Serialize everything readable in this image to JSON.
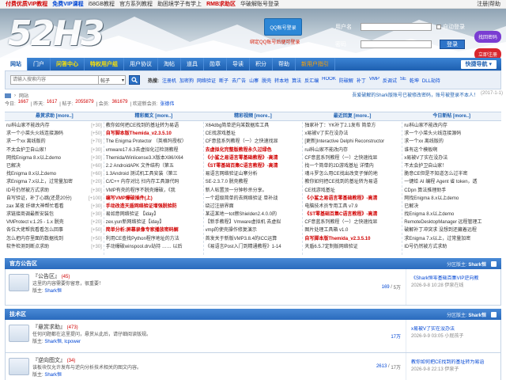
{
  "topbar": {
    "links": [
      "付费优质VIP教程",
      "免费VIP课程",
      "i58GB教程",
      "官方系列教程",
      "助困境学子有学上",
      "RMB求助区",
      "华破解账号登录"
    ],
    "styles": [
      "hl-red",
      "hl-blue",
      "",
      "",
      "",
      "hl-red",
      ""
    ],
    "right": "注册|帮助"
  },
  "header": {
    "logo": "52H3",
    "qq_btn": "QQ账号登录",
    "qq_tip": "绑定QQ账号后便可登录",
    "login": {
      "user_label": "用户名",
      "user_placeholder": "",
      "auto_label": "自动登录",
      "pass_label": "密码",
      "login_btn": "登录"
    },
    "find_btn": "找回密码",
    "reg_btn": "立即注册"
  },
  "nav": {
    "items": [
      {
        "label": "网站",
        "style": "on"
      },
      {
        "label": "门户",
        "style": ""
      },
      {
        "label": "问答中心",
        "style": "y"
      },
      {
        "label": "特权用户组",
        "style": "y"
      },
      {
        "label": "用户协议",
        "style": ""
      },
      {
        "label": "淘帖",
        "style": ""
      },
      {
        "label": "道具",
        "style": ""
      },
      {
        "label": "勋章",
        "style": ""
      },
      {
        "label": "导读",
        "style": ""
      },
      {
        "label": "积分",
        "style": ""
      },
      {
        "label": "帮助",
        "style": ""
      },
      {
        "label": "新用户指引",
        "style": "o"
      }
    ],
    "quick": "快捷导航 ▾"
  },
  "search": {
    "placeholder": "请输入搜索内容",
    "scope": "帖子",
    "hot_label": "热搜:",
    "hot": [
      "注册机",
      "加密狗",
      "网络验证",
      "断子",
      "去广告",
      "山寨",
      "脱壳",
      "转本地",
      "算法",
      "反汇编",
      "HOOK",
      "防破解",
      "补丁",
      "VMP",
      "反调试",
      "SE",
      "乾坤",
      "DLL劫持"
    ]
  },
  "crumb": {
    "text": "网站"
  },
  "notice": {
    "text": "吾爱破解的Shark版账号已被修改密码，账号被登录不本人！",
    "date": "(2017-1-1)"
  },
  "stats": {
    "labels": [
      "今日:",
      "| 昨天:",
      "| 帖子:",
      "| 会员:",
      "| 欢迎新会员:"
    ],
    "values": [
      "1667",
      "1617",
      "2055879",
      "361679",
      "张德伟"
    ]
  },
  "columns": {
    "headers": [
      "悬赏求助 [more..]",
      "精彩图文 [more..]",
      "精彩视频 [more..]",
      "最近回复 [more..]",
      "今日新帖 [more..]"
    ],
    "lists": [
      [
        {
          "t": "rui科山家不能改内存",
          "n": "[+30]",
          "s": ""
        },
        {
          "t": "求一个小菜头火线连接源码",
          "n": "[+50]",
          "s": ""
        },
        {
          "t": "求一个xx 离线版的",
          "n": "[+70]",
          "s": ""
        },
        {
          "t": "不太会护卫自山家！",
          "n": "[+30]",
          "s": ""
        },
        {
          "t": "网找Enigma 8.x以上demo",
          "n": "[+30]",
          "s": ""
        },
        {
          "t": "已解决",
          "n": "[+60]",
          "s": ""
        },
        {
          "t": "找Enigma 8.x以上demo",
          "n": "[+60]",
          "s": ""
        },
        {
          "t": "求Enigma 7.x以上，过常量加密",
          "n": "[+20]",
          "s": ""
        },
        {
          "t": "ID号仍然被方式求助",
          "n": "[+30]",
          "s": ""
        },
        {
          "t": "自写验证，补丁心跳(还是20分)",
          "n": "[+100]",
          "s": ""
        },
        {
          "t": "zax 某夜 纤继大神帮忙看看",
          "n": "[+30]",
          "s": ""
        },
        {
          "t": "求链接商调最新安装包",
          "n": "[+30]",
          "s": ""
        },
        {
          "t": "VMProtect v.1.25 - 1.x 脱壳",
          "n": "[+20]",
          "s": ""
        },
        {
          "t": "各位大佬帮我看看怎么回事",
          "n": "[+50]",
          "s": ""
        },
        {
          "t": "怎么把内存里面的数据找到",
          "n": "[+50]",
          "s": ""
        },
        {
          "t": "软件检测到断点求助",
          "n": "[+30]",
          "s": ""
        }
      ],
      [
        {
          "t": "教你如何把CE找到的基址转为易语",
          "n": "",
          "s": ""
        },
        {
          "t": "自写脚本版Themida_v2.3.5.10",
          "n": "",
          "s": "r"
        },
        {
          "t": "The Enigma Protector （英格玛授权）",
          "n": "",
          "s": ""
        },
        {
          "t": "vmware17.6.3去虚拟化过检测教程",
          "n": "",
          "s": ""
        },
        {
          "t": "Themida/Winlicense3.X版本X86/X64",
          "n": "",
          "s": ""
        },
        {
          "t": "2.2 AndroidAPK 文件结构（第五",
          "n": "",
          "s": ""
        },
        {
          "t": "1.3Android 测试机工具安装（第三",
          "n": "",
          "s": ""
        },
        {
          "t": "C/C++ 内存对比 扫内存工具源代码",
          "n": "",
          "s": ""
        },
        {
          "t": "VMP有壳的程序不脱壳爆破，《我",
          "n": "",
          "s": ""
        },
        {
          "t": "编写VMP爆破插件(上)",
          "n": "",
          "s": "r"
        },
        {
          "t": "手动改造天盾网络验证增强脱验防",
          "n": "",
          "s": "r"
        },
        {
          "t": "易如意网络验证 【iday】",
          "n": "",
          "s": ""
        },
        {
          "t": "zex.yun新网络验证【iday】",
          "n": "",
          "s": ""
        },
        {
          "t": "简单分析:屏幕录像专家播放密码解",
          "n": "",
          "s": "r"
        },
        {
          "t": "利用CE查找Python程序地址的方法",
          "n": "",
          "s": ""
        },
        {
          "t": "手动爆破winspool.drv劫持 …… 以后",
          "n": "",
          "s": ""
        }
      ],
      [
        {
          "t": "X64dbg简单逆向某数据库工具",
          "n": "",
          "s": ""
        },
        {
          "t": "CE找游戏基址",
          "n": "",
          "s": ""
        },
        {
          "t": "CF意蓝系列教程（一）之快速找显",
          "n": "",
          "s": ""
        },
        {
          "t": "去虚拟化完整版教程永久过绿色",
          "n": "",
          "s": "r"
        },
        {
          "t": "《小鲨之易语言零基础教程》-高清",
          "n": "",
          "s": "r"
        },
        {
          "t": "《ST零基础百集C语言教程》-高清",
          "n": "",
          "s": "r"
        },
        {
          "t": "易语言网络验证山寨分析",
          "n": "",
          "s": ""
        },
        {
          "t": "SE-2.3.7.0 脱壳教程",
          "n": "",
          "s": ""
        },
        {
          "t": "新人帖置顶一分钟秒杀分享。",
          "n": "",
          "s": ""
        },
        {
          "t": "一个超级简单的去网络验证 单补战",
          "n": "",
          "s": ""
        },
        {
          "t": "绕过注册界面",
          "n": "",
          "s": ""
        },
        {
          "t": "某逗某地一tot擦Shielden2.4.0.0的",
          "n": "",
          "s": ""
        },
        {
          "t": "【新手教程】Vmware虚拟机 去虚拟",
          "n": "",
          "s": ""
        },
        {
          "t": "vmp的使壳操作修复演示",
          "n": "",
          "s": ""
        },
        {
          "t": "首发关于新版VMP3.8.4的ICC运算",
          "n": "",
          "s": ""
        },
        {
          "t": "《易语言Post入门到精通教程》1-14",
          "n": "",
          "s": ""
        }
      ],
      [
        {
          "t": "独家补丁：YK补丁2.1发布 简单方",
          "n": "",
          "s": ""
        },
        {
          "t": "x易被V了实在没办法",
          "n": "",
          "s": ""
        },
        {
          "t": "[更新]Interactive Delphi Reconstructor",
          "n": "",
          "s": ""
        },
        {
          "t": "rui科山家不能改内存",
          "n": "",
          "s": ""
        },
        {
          "t": "CF意蓝系列教程（一）之快速找显",
          "n": "",
          "s": ""
        },
        {
          "t": "找一个简单的2D游戏基址 详情内",
          "n": "",
          "s": ""
        },
        {
          "t": "魂斗罗怎么用CE找出改变子弹的地",
          "n": "",
          "s": ""
        },
        {
          "t": "教你如何把CE找到的基址转为易语",
          "n": "",
          "s": ""
        },
        {
          "t": "CE找游戏基址",
          "n": "",
          "s": ""
        },
        {
          "t": "《小鲨之易语言零基础教程》-高清",
          "n": "",
          "s": "r"
        },
        {
          "t": "电脑技术员专用工具 v7.9",
          "n": "",
          "s": ""
        },
        {
          "t": "《ST零基础百集C语言教程》-高清",
          "n": "",
          "s": "r"
        },
        {
          "t": "CF意蓝系列教程（一）之快速找显",
          "n": "",
          "s": ""
        },
        {
          "t": "图片处理工具箱 v1.0",
          "n": "",
          "s": ""
        },
        {
          "t": "自写脚本版Themida_v2.3.5.10",
          "n": "",
          "s": "r"
        },
        {
          "t": "天盾6.5.7定制版网络验证",
          "n": "",
          "s": ""
        }
      ],
      [
        {
          "t": "rui科山家不能改内存",
          "n": "",
          "s": ""
        },
        {
          "t": "求一个小菜头火线连接源码",
          "n": "",
          "s": ""
        },
        {
          "t": "求一个xx 离线版的",
          "n": "",
          "s": ""
        },
        {
          "t": "谁有这个模板啊",
          "n": "",
          "s": ""
        },
        {
          "t": "x易被V了实在没办法",
          "n": "",
          "s": ""
        },
        {
          "t": "不太会护卫自山家！",
          "n": "",
          "s": ""
        },
        {
          "t": "脆意CE但是不知道怎么过半密",
          "n": "",
          "s": ""
        },
        {
          "t": "一键给 AI 编程 Agent 省 token，透",
          "n": "",
          "s": ""
        },
        {
          "t": "CDpn 算法推理助手",
          "n": "",
          "s": ""
        },
        {
          "t": "网找Enigma 8.x以上demo",
          "n": "",
          "s": ""
        },
        {
          "t": "已解决",
          "n": "",
          "s": ""
        },
        {
          "t": "找Enigma 8.x以上demo",
          "n": "",
          "s": ""
        },
        {
          "t": "RemoteDesktopManager 远程管理工",
          "n": "",
          "s": ""
        },
        {
          "t": "破解补丁冲突求 没想到还藏着远程",
          "n": "",
          "s": ""
        },
        {
          "t": "求Enigma 7.x以上，过常量加密",
          "n": "",
          "s": ""
        },
        {
          "t": "ID号仍然被方式求助",
          "n": "",
          "s": ""
        }
      ]
    ]
  },
  "section1": {
    "title": "官方公告区",
    "mod_label": "分区版主:",
    "mod_name": "Shark恒"
  },
  "forum1": {
    "name": "『公告区』",
    "today": "(45)",
    "desc": "这里的内容需要你留意，很重要！",
    "mods_label": "版主:",
    "mods": "Shark恒",
    "count_a": "169",
    "count_b": "5万",
    "last_title": "《Shark恒零基础百集VIP逆向教",
    "last_meta": "2026-9-8 10:28 伊泉在线"
  },
  "section2": {
    "title": "技术区",
    "mod_label": "分区版主:",
    "mod_name": "Shark恒"
  },
  "forum2": {
    "name": "『悬赏求助』",
    "today": "(473)",
    "desc": "任何问题都在这里提问，悬赏从此后，请仔细阅读版规。",
    "mods_label": "版主:",
    "mods": "Shark恒, lcpower",
    "count_a": "17万",
    "count_b": "",
    "last_title": "x易被V了实在没办法",
    "last_meta": "2026-9-9 03:05 小屁孩子"
  },
  "forum3": {
    "name": "『逆向图文』",
    "today": "(34)",
    "desc": "该板块仅允许发布与逆向分析技术相关的图文内容。",
    "mods_label": "版主:",
    "mods": "Shark恒",
    "count_a": "2613",
    "count_b": "17万",
    "last_title": "教你如何把CE找到的基址转为易语",
    "last_meta": "2026-9-8 22:13 伊泉子"
  }
}
